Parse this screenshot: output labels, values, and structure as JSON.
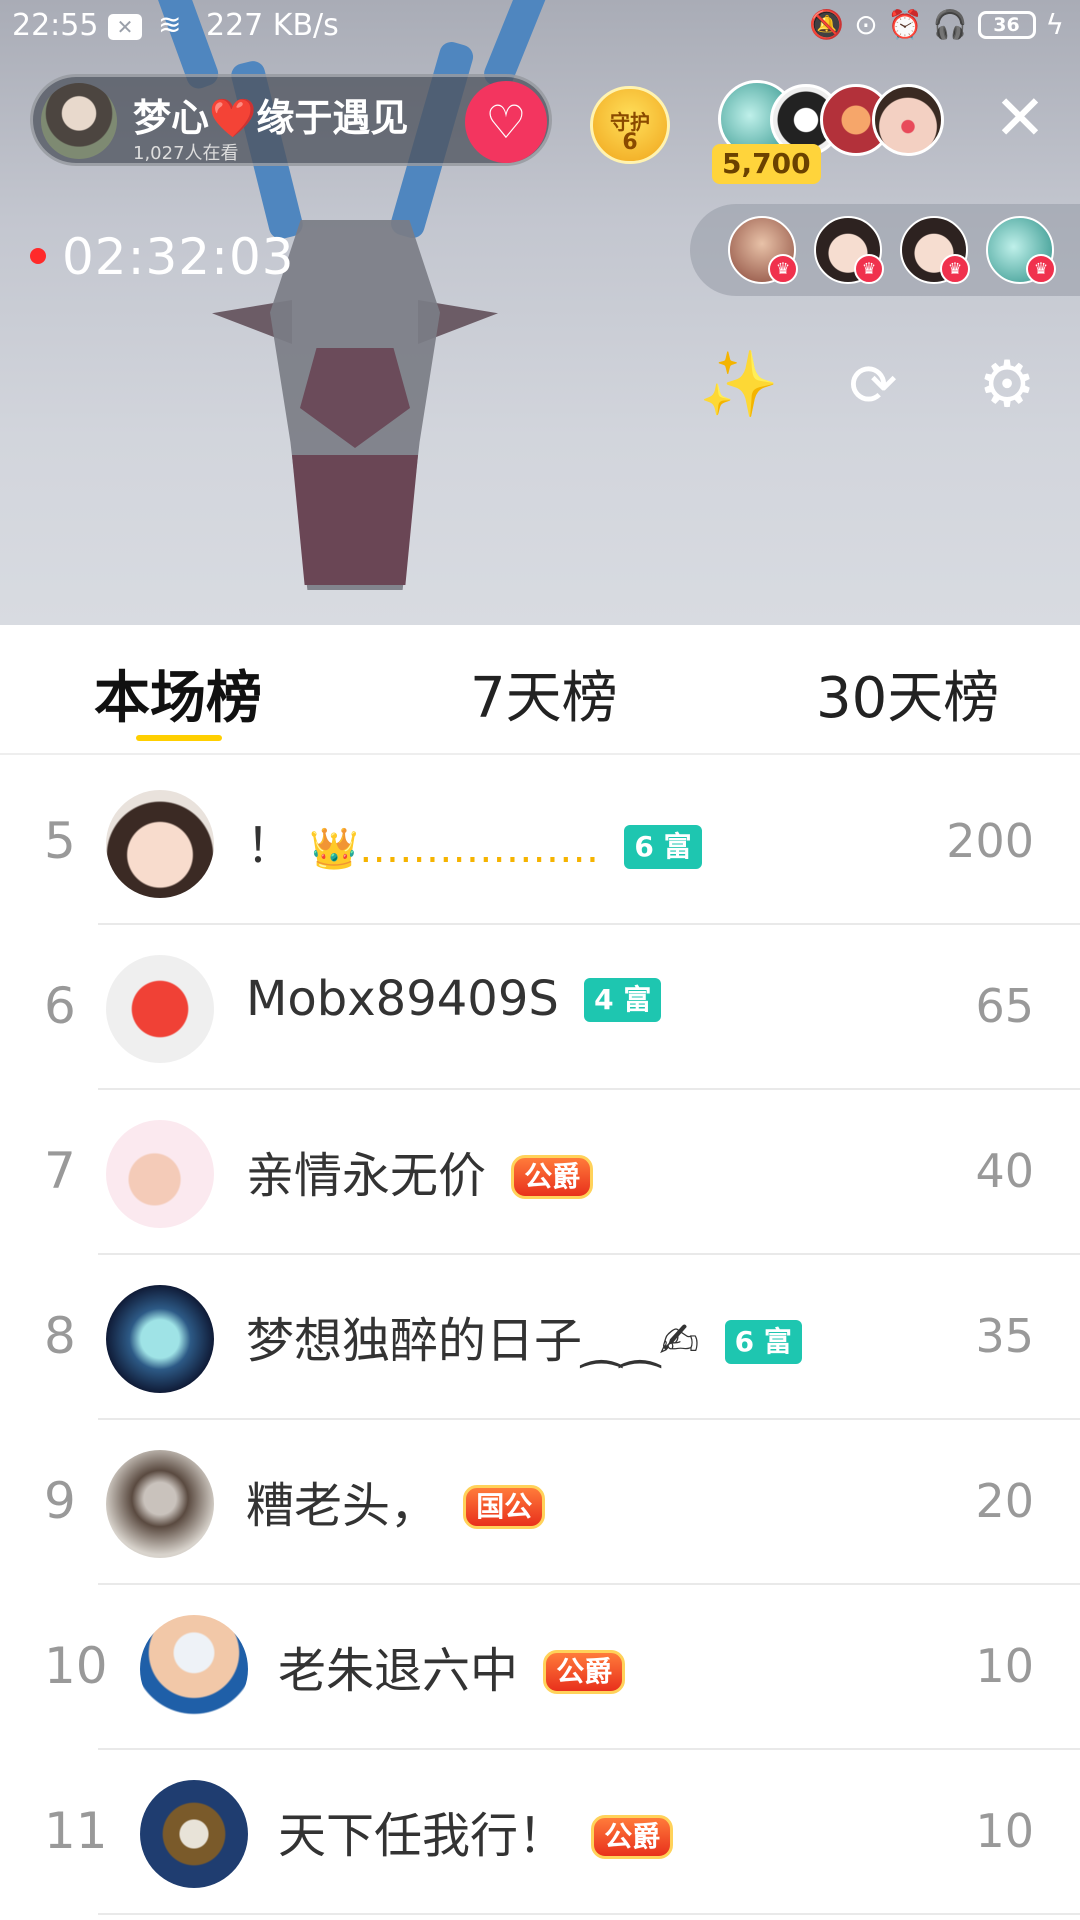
{
  "status_bar": {
    "time": "22:55",
    "speed": "227 KB/s",
    "battery": "36",
    "icons": [
      "sim-x-icon",
      "wifi-icon",
      "mute-bell-icon",
      "lock-rotation-icon",
      "alarm-icon",
      "headphones-icon",
      "battery-icon",
      "charging-icon"
    ]
  },
  "live": {
    "host_name": "梦心❤️缘于遇见",
    "viewer_count_text": "1,027人在看",
    "guard_label": "守护",
    "guard_count": "6",
    "fan_coins": "5,700",
    "elapsed": "02:32:03",
    "accent": "#f3355f"
  },
  "tabs": [
    {
      "label": "本场榜",
      "active": true
    },
    {
      "label": "7天榜",
      "active": false
    },
    {
      "label": "30天榜",
      "active": false
    }
  ],
  "tab_accent": "#ffcf00",
  "leaderboard": [
    {
      "rank": "5",
      "name": "！",
      "extra": "👑………………",
      "badge": "6 富",
      "badge_type": "rich",
      "score": "200"
    },
    {
      "rank": "6",
      "name": "Mobx89409S",
      "extra": "",
      "badge": "4 富",
      "badge_type": "rich",
      "score": "65"
    },
    {
      "rank": "7",
      "name": "亲情永无价",
      "extra": "",
      "badge": "公爵",
      "badge_type": "noble",
      "score": "40"
    },
    {
      "rank": "8",
      "name": "梦想独醉的日子⁔⁔✍",
      "extra": "",
      "badge": "6 富",
      "badge_type": "rich",
      "score": "35"
    },
    {
      "rank": "9",
      "name": "糟老头，",
      "extra": "",
      "badge": "国公",
      "badge_type": "noble",
      "score": "20"
    },
    {
      "rank": "10",
      "name": "老朱退六中",
      "extra": "",
      "badge": "公爵",
      "badge_type": "noble",
      "score": "10"
    },
    {
      "rank": "11",
      "name": "天下任我行！",
      "extra": "",
      "badge": "公爵",
      "badge_type": "noble",
      "score": "10"
    }
  ]
}
